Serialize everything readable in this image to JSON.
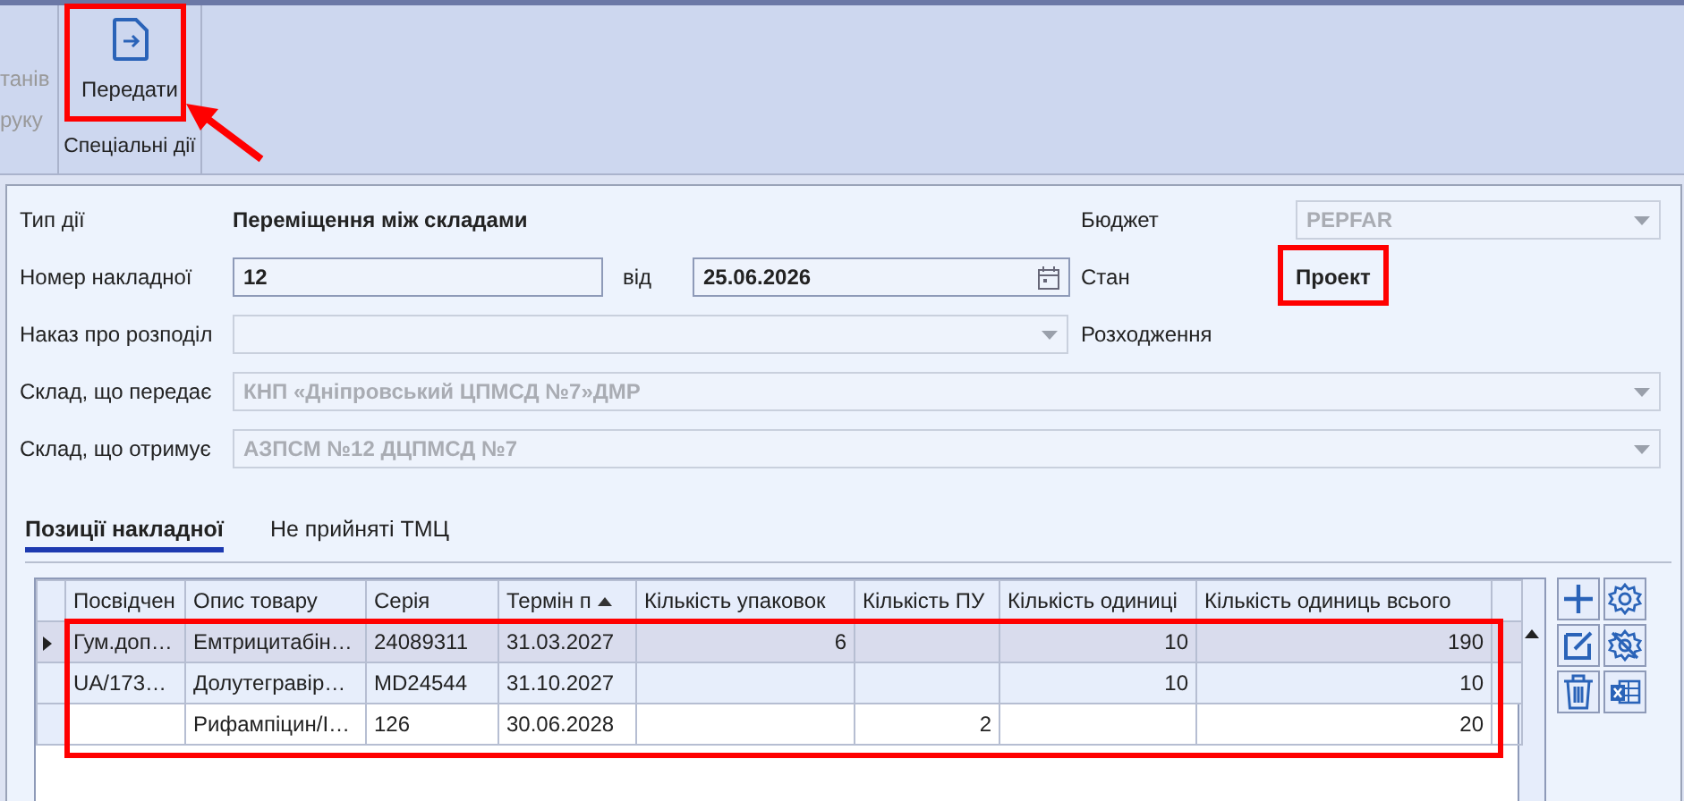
{
  "ribbon": {
    "cut_labels": [
      "танів",
      "руку"
    ],
    "button": {
      "label": "Передати"
    },
    "group_label": "Спеціальні дії"
  },
  "form": {
    "operation_type": {
      "label": "Тип дії",
      "value": "Переміщення між складами"
    },
    "invoice_number": {
      "label": "Номер накладної",
      "value": "12"
    },
    "date": {
      "label": "від",
      "value": "25.06.2026"
    },
    "order": {
      "label": "Наказ про розподіл",
      "disabled": true
    },
    "sender": {
      "label": "Склад, що передає",
      "value": "КНП «Дніпровський ЦПМСД №7»ДМР",
      "disabled": true
    },
    "receiver": {
      "label": "Склад, що отримує",
      "value": "АЗПСМ №12 ДЦПМСД №7",
      "disabled": true
    },
    "budget": {
      "label": "Бюджет",
      "value": "PEPFAR",
      "disabled": true
    },
    "status": {
      "label": "Стан",
      "value": "Проект"
    },
    "discrepancy": {
      "label": "Розходження"
    }
  },
  "tabs": [
    {
      "label": "Позиції накладної",
      "selected": true
    },
    {
      "label": "Не прийняті ТМЦ",
      "selected": false
    }
  ],
  "table": {
    "columns": [
      {
        "label": "Посвідчен"
      },
      {
        "label": "Опис товару"
      },
      {
        "label": "Серія"
      },
      {
        "label": "Термін п",
        "sorted": true
      },
      {
        "label": "Кількість упаковок"
      },
      {
        "label": "Кількість ПУ"
      },
      {
        "label": "Кількість одиниці"
      },
      {
        "label": "Кількість одиниць всього"
      }
    ],
    "rows": [
      {
        "selected": true,
        "cells": [
          "Гум.доп…",
          "Емтрицитабін…",
          "24089311",
          "31.03.2027",
          "6",
          null,
          "10",
          "190"
        ]
      },
      {
        "selected": false,
        "cells": [
          "UA/173…",
          "Долутегравір…",
          "MD24544",
          "31.10.2027",
          null,
          null,
          "10",
          "10"
        ]
      },
      {
        "selected": false,
        "cells": [
          null,
          "Рифампіцин/І…",
          "126",
          "30.06.2028",
          null,
          "2",
          null,
          "20"
        ]
      }
    ]
  }
}
